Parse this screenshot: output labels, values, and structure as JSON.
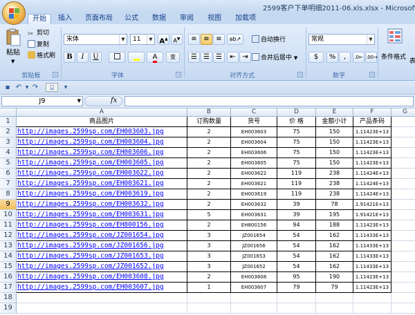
{
  "window": {
    "title": "2599客户下单明细2011-06.xls.xlsx - Microsoft"
  },
  "tabs": [
    "开始",
    "插入",
    "页面布局",
    "公式",
    "数据",
    "审阅",
    "视图",
    "加载项"
  ],
  "ribbon": {
    "clipboard": {
      "paste": "粘贴",
      "cut": "剪切",
      "copy": "复制",
      "format_painter": "格式刷",
      "label": "剪贴板"
    },
    "font": {
      "name": "宋体",
      "size": "11",
      "grow": "A",
      "shrink": "A",
      "bold": "B",
      "italic": "I",
      "underline": "U",
      "font_color_letter": "A",
      "phonetic": "变",
      "label": "字体"
    },
    "alignment": {
      "wrap": "自动换行",
      "merge": "合并后居中",
      "label": "对齐方式"
    },
    "number": {
      "format": "常规",
      "percent": "%",
      "comma": ",",
      "label": "数字"
    },
    "styles": {
      "conditional": "条件格式",
      "more": "表"
    }
  },
  "formula_bar": {
    "name_box": "J9",
    "fx": "fx",
    "value": ""
  },
  "columns": [
    "A",
    "B",
    "C",
    "D",
    "E",
    "F",
    "G"
  ],
  "header_row": [
    "商品图片",
    "订购数量",
    "货号",
    "价 格",
    "金额小计",
    "产品条码"
  ],
  "rows": [
    [
      "http://images.2599sp.com/EH003603.jpg",
      "2",
      "EH003603",
      "75",
      "150",
      "1.11423E+13"
    ],
    [
      "http://images.2599sp.com/EH003604.jpg",
      "2",
      "EH003604",
      "75",
      "150",
      "1.11423E+13"
    ],
    [
      "http://images.2599sp.com/EH003606.jpg",
      "2",
      "EH003606",
      "75",
      "150",
      "1.11423E+13"
    ],
    [
      "http://images.2599sp.com/EH003605.jpg",
      "2",
      "EH003605",
      "75",
      "150",
      "1.11423E+13"
    ],
    [
      "http://images.2599sp.com/EH003622.jpg",
      "2",
      "EH003622",
      "119",
      "238",
      "1.11424E+13"
    ],
    [
      "http://images.2599sp.com/EH003621.jpg",
      "2",
      "EH003621",
      "119",
      "238",
      "1.11424E+13"
    ],
    [
      "http://images.2599sp.com/EH003619.jpg",
      "2",
      "EH003619",
      "119",
      "238",
      "1.11424E+13"
    ],
    [
      "http://images.2599sp.com/EH003632.jpg",
      "2",
      "EH003632",
      "39",
      "78",
      "1.91421E+13"
    ],
    [
      "http://images.2599sp.com/EH003631.jpg",
      "5",
      "EH003631",
      "39",
      "195",
      "1.91421E+13"
    ],
    [
      "http://images.2599sp.com/EH800156.jpg",
      "2",
      "EH800156",
      "94",
      "188",
      "1.11423E+13"
    ],
    [
      "http://images.2599sp.com/JZ001654.jpg",
      "3",
      "JZ001654",
      "54",
      "162",
      "1.11433E+13"
    ],
    [
      "http://images.2599sp.com/JZ001656.jpg",
      "3",
      "JZ001656",
      "54",
      "162",
      "1.11433E+13"
    ],
    [
      "http://images.2599sp.com/JZ001653.jpg",
      "3",
      "JZ001653",
      "54",
      "162",
      "1.11433E+13"
    ],
    [
      "http://images.2599sp.com/JZ001652.jpg",
      "3",
      "JZ001652",
      "54",
      "162",
      "1.11433E+13"
    ],
    [
      "http://images.2599sp.com/EH003608.jpg",
      "2",
      "EH003608",
      "95",
      "190",
      "1.11423E+13"
    ],
    [
      "http://images.2599sp.com/EH003607.jpg",
      "1",
      "EH003607",
      "79",
      "79",
      "1.11423E+13"
    ]
  ],
  "row_numbers": [
    "1",
    "2",
    "3",
    "4",
    "5",
    "6",
    "7",
    "8",
    "9",
    "10",
    "11",
    "12",
    "13",
    "14",
    "15",
    "16",
    "17",
    "18",
    "19"
  ],
  "selected_row": "9",
  "colors": {
    "link": "#0000ff",
    "ribbon_bg": "#dbe7f7",
    "tab_text": "#15428b",
    "selected_header": "#f1c15f"
  }
}
